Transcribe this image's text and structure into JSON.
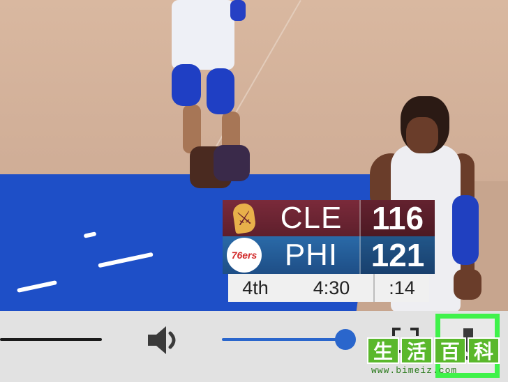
{
  "scoreboard": {
    "away": {
      "team": "CLE",
      "score": "116",
      "logo": "cavaliers-logo"
    },
    "home": {
      "team": "PHI",
      "score": "121",
      "logo": "76ers-logo",
      "logo_text": "76ers"
    },
    "period": "4th",
    "clock": "4:30",
    "shot_clock": ":14"
  },
  "controls": {
    "volume_level": 0.92,
    "accent_color": "#2a66cc",
    "highlight_color": "#3ff24a",
    "icons": [
      "volume-icon",
      "fullscreen-icon",
      "download-icon"
    ]
  },
  "watermark": {
    "chars": [
      "生",
      "活",
      "百",
      "科"
    ],
    "url": "www.bimeiz.com"
  }
}
